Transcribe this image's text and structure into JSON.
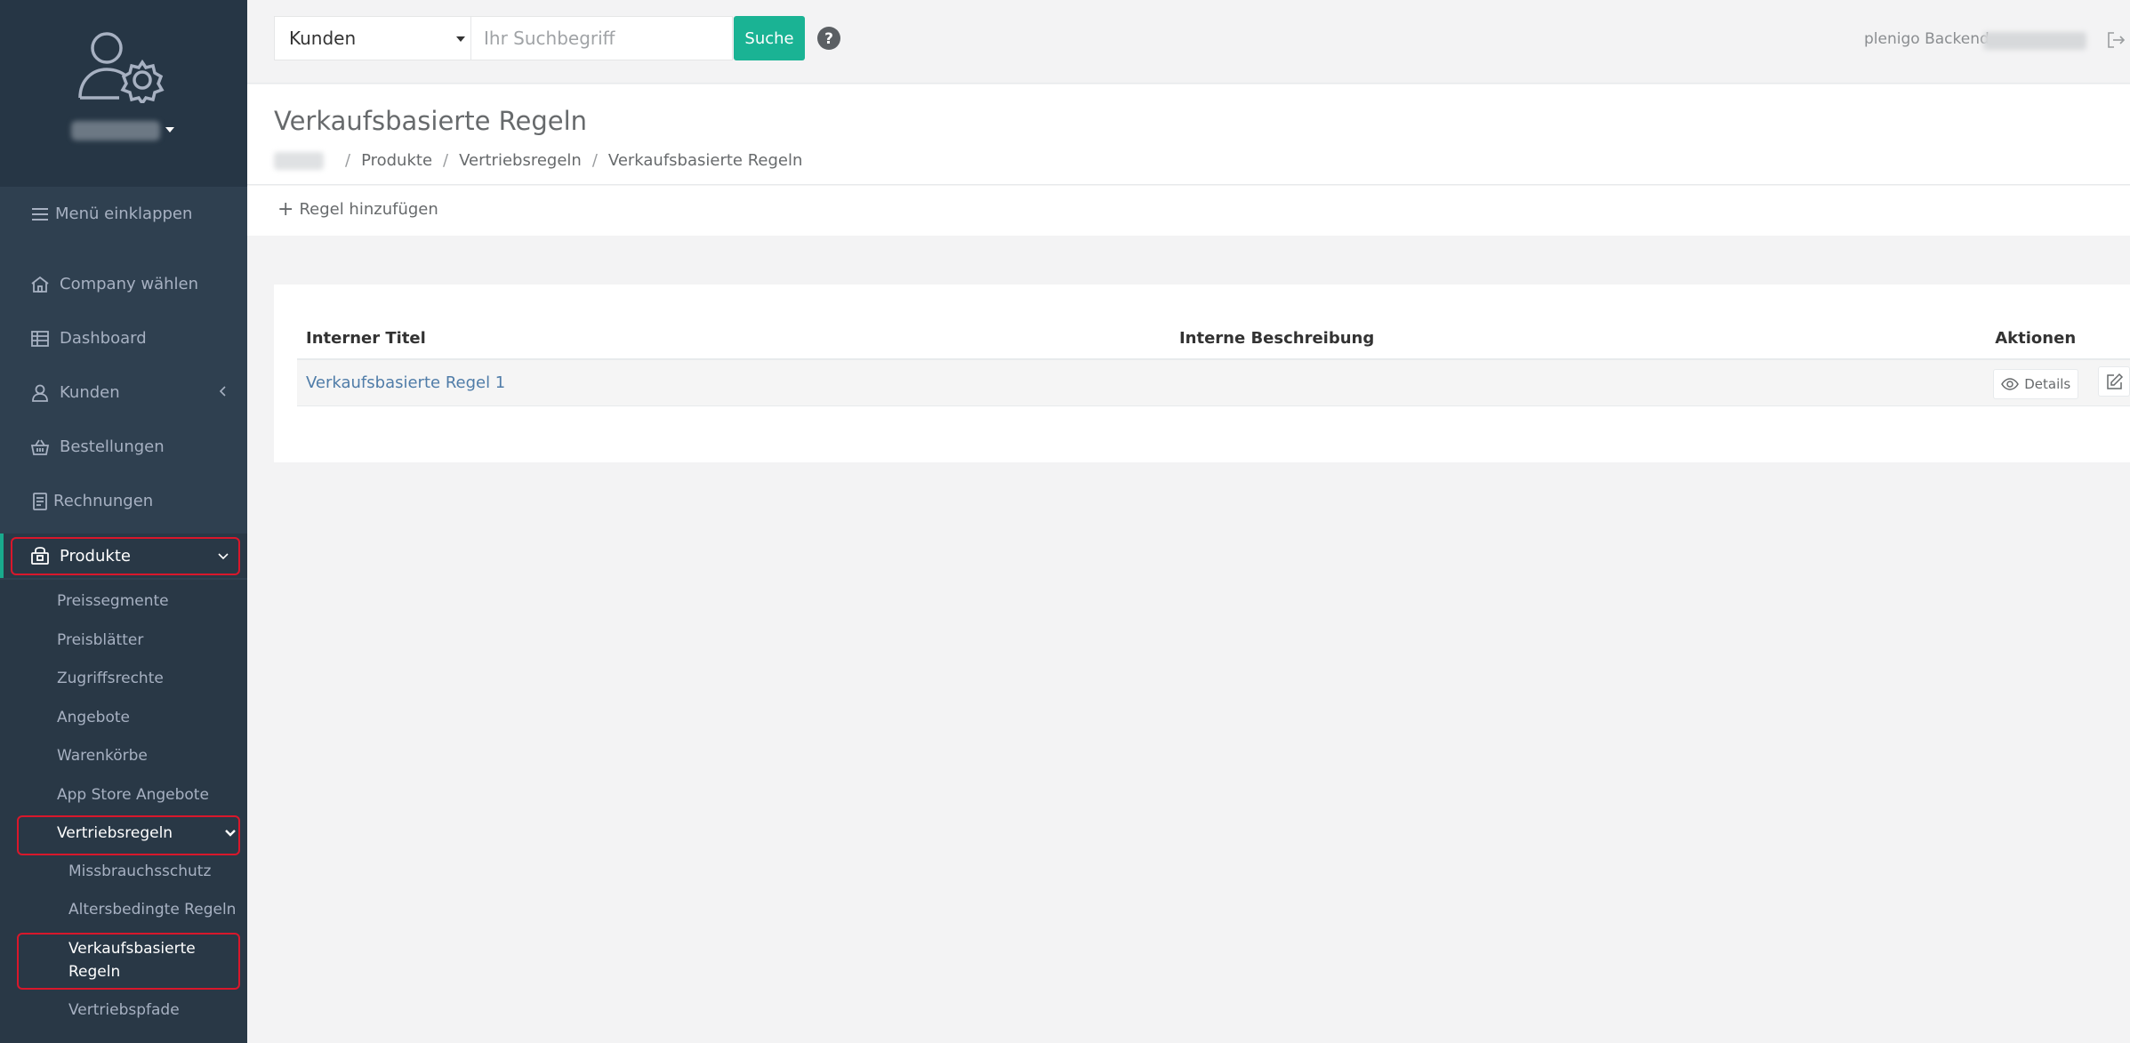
{
  "sidebar": {
    "collapse_label": "Menü einklappen",
    "items": [
      {
        "label": "Company wählen"
      },
      {
        "label": "Dashboard"
      },
      {
        "label": "Kunden"
      },
      {
        "label": "Bestellungen"
      },
      {
        "label": "Rechnungen"
      },
      {
        "label": "Produkte"
      }
    ],
    "produkte_sub": [
      {
        "label": "Preissegmente"
      },
      {
        "label": "Preisblätter"
      },
      {
        "label": "Zugriffsrechte"
      },
      {
        "label": "Angebote"
      },
      {
        "label": "Warenkörbe"
      },
      {
        "label": "App Store Angebote"
      },
      {
        "label": "Vertriebsregeln"
      }
    ],
    "vertriebsregeln_sub": [
      {
        "label": "Missbrauchsschutz"
      },
      {
        "label": "Altersbedingte Regeln"
      },
      {
        "label": "Verkaufsbasierte Regeln"
      },
      {
        "label": "Vertriebspfade"
      }
    ]
  },
  "topbar": {
    "search_type": "Kunden",
    "search_placeholder": "Ihr Suchbegriff",
    "search_button": "Suche",
    "backend_label": "plenigo Backend"
  },
  "page": {
    "title": "Verkaufsbasierte Regeln",
    "breadcrumb": [
      "Produkte",
      "Vertriebsregeln",
      "Verkaufsbasierte Regeln"
    ],
    "add_label": "Regel hinzufügen"
  },
  "table": {
    "headers": [
      "Interner Titel",
      "Interne Beschreibung",
      "Aktionen"
    ],
    "rows": [
      {
        "title": "Verkaufsbasierte Regel 1",
        "description": "",
        "details_label": "Details"
      }
    ]
  },
  "colors": {
    "sidebar_bg": "#2f4050",
    "accent": "#1ab394",
    "highlight_border": "#d9172b",
    "link": "#4f7ca8"
  }
}
